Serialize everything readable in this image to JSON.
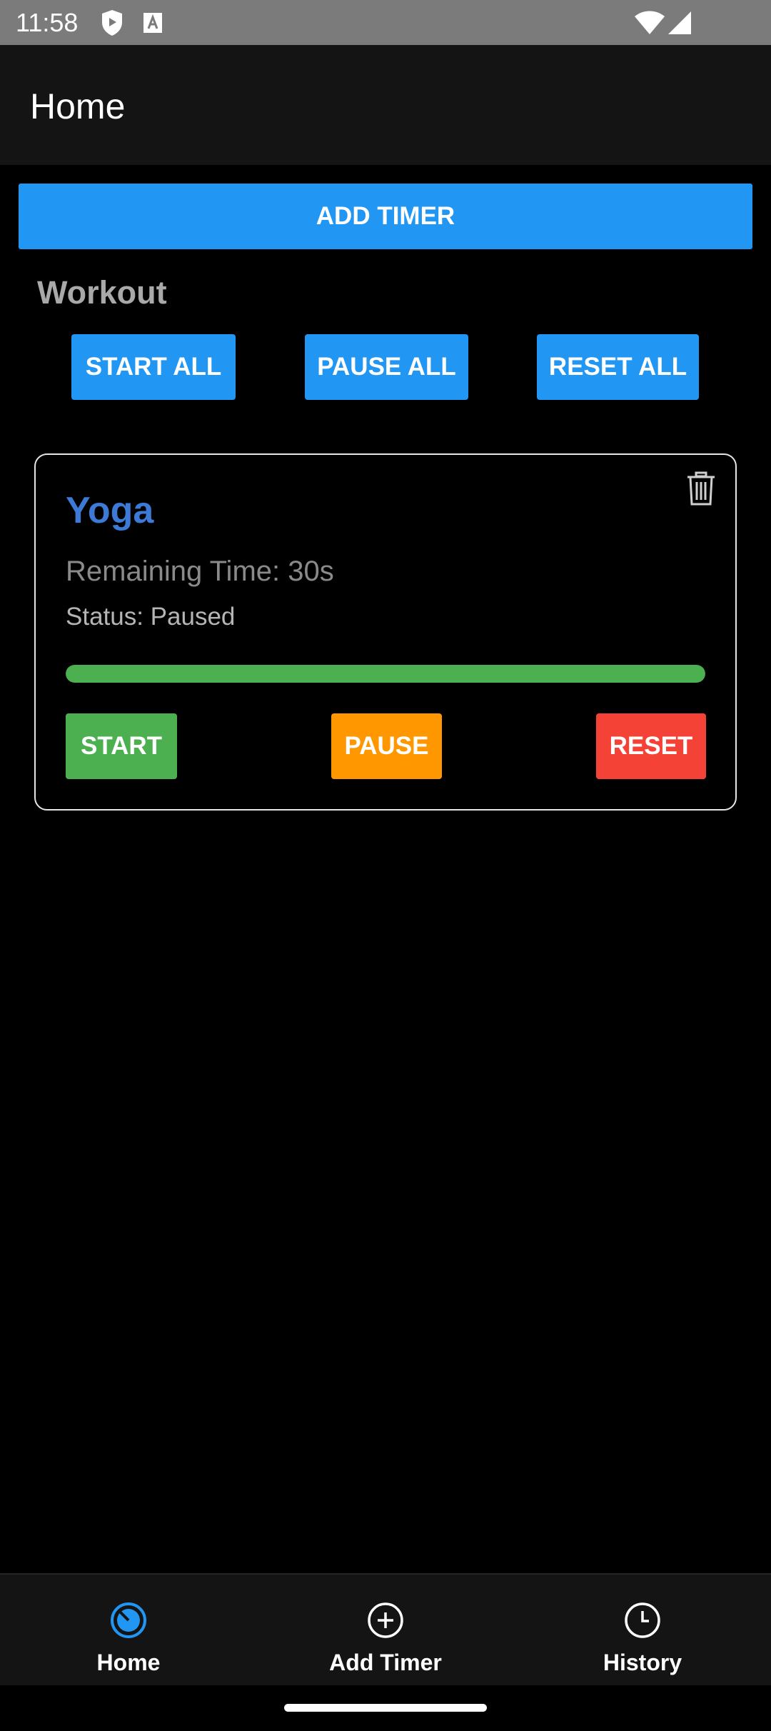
{
  "status_bar": {
    "time": "11:58",
    "icons": [
      "shield-icon",
      "a-badge-icon",
      "wifi-icon",
      "signal-icon"
    ]
  },
  "app_bar": {
    "title": "Home"
  },
  "add_timer_button": {
    "label": "ADD TIMER"
  },
  "group": {
    "title": "Workout",
    "start_all_label": "START ALL",
    "pause_all_label": "PAUSE ALL",
    "reset_all_label": "RESET ALL"
  },
  "timer": {
    "name": "Yoga",
    "remaining": "Remaining Time: 30s",
    "status": "Status: Paused",
    "progress_fraction": 1.0,
    "start_label": "START",
    "pause_label": "PAUSE",
    "reset_label": "RESET",
    "delete_icon": "trash-icon"
  },
  "bottom_nav": {
    "items": [
      {
        "label": "Home",
        "icon": "timer-icon",
        "active": true
      },
      {
        "label": "Add Timer",
        "icon": "add-circle-icon",
        "active": false
      },
      {
        "label": "History",
        "icon": "clock-icon",
        "active": false
      }
    ]
  },
  "colors": {
    "primary": "#2196f3",
    "start": "#4caf50",
    "pause": "#ff9800",
    "reset": "#f44336",
    "timer_name": "#3d7ad6",
    "active_nav": "#2196f3"
  }
}
